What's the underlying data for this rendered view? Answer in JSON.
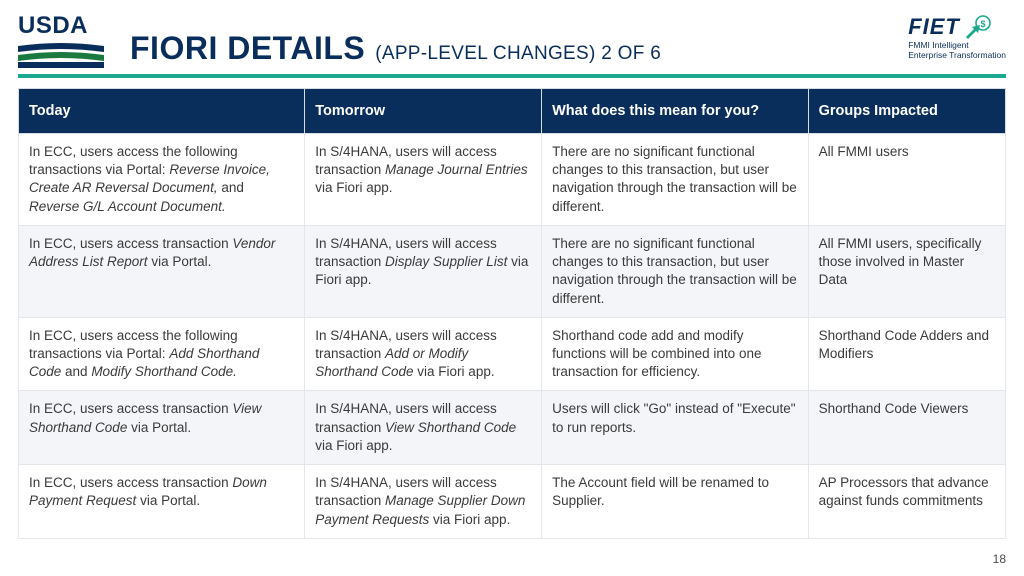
{
  "header": {
    "usda_label": "USDA",
    "title_main": "FIORI DETAILS",
    "title_sub": "(APP-LEVEL CHANGES) 2 OF 6",
    "fiet_label": "FIET",
    "fiet_sub1": "FMMI Intelligent",
    "fiet_sub2": "Enterprise Transformation"
  },
  "table": {
    "headers": {
      "today": "Today",
      "tomorrow": "Tomorrow",
      "mean": "What does this mean for you?",
      "groups": "Groups Impacted"
    },
    "rows": [
      {
        "today_html": "In ECC, users access the following transactions via Portal: <em>Reverse Invoice, Create AR Reversal Document,</em> and <em>Reverse G/L Account Document.</em>",
        "tomorrow_html": "In S/4HANA, users will access transaction <em>Manage Journal Entries</em> via Fiori app.",
        "mean": "There are no significant functional changes to this transaction, but user navigation through the transaction will be different.",
        "groups": "All FMMI users"
      },
      {
        "today_html": "In ECC, users access transaction <em>Vendor Address List Report</em> via Portal.",
        "tomorrow_html": "In S/4HANA, users will access transaction <em>Display Supplier List</em> via Fiori app.",
        "mean": "There are no significant functional changes to this transaction, but user navigation through the transaction will be different.",
        "groups": "All FMMI users, specifically those involved in Master Data"
      },
      {
        "today_html": "In ECC, users access the following transactions via Portal: <em>Add Shorthand Code</em> and <em>Modify Shorthand Code.</em>",
        "tomorrow_html": "In S/4HANA, users will access transaction <em>Add or Modify Shorthand Code</em> via Fiori app.",
        "mean": "Shorthand code add and modify functions will be combined into one transaction for efficiency.",
        "groups": "Shorthand Code Adders and Modifiers"
      },
      {
        "today_html": "In ECC, users access transaction <em>View Shorthand Code</em> via Portal.",
        "tomorrow_html": "In S/4HANA, users will access transaction <em>View Shorthand Code</em> via Fiori app.",
        "mean": "Users will click \"Go\" instead of \"Execute\" to run reports.",
        "groups": "Shorthand Code Viewers"
      },
      {
        "today_html": "In ECC, users access transaction <em>Down Payment Request</em> via Portal.",
        "tomorrow_html": "In S/4HANA, users will access transaction <em>Manage Supplier Down Payment Requests</em> via Fiori app.",
        "mean": "The Account field will be renamed to Supplier.",
        "groups": "AP Processors that advance against funds commitments"
      }
    ]
  },
  "page_number": "18"
}
